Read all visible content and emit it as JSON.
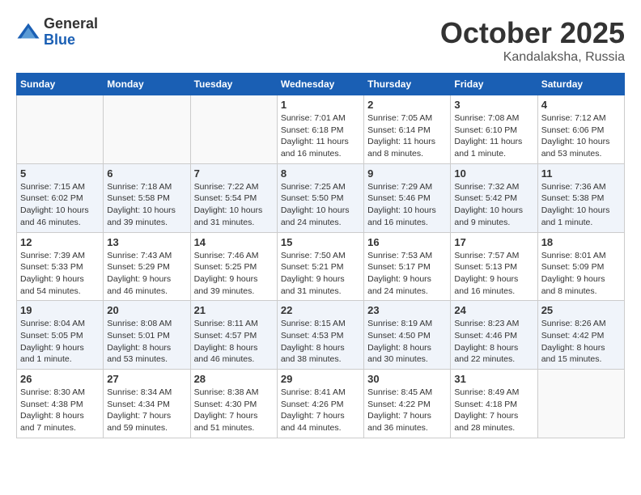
{
  "header": {
    "logo_general": "General",
    "logo_blue": "Blue",
    "month": "October 2025",
    "location": "Kandalaksha, Russia"
  },
  "weekdays": [
    "Sunday",
    "Monday",
    "Tuesday",
    "Wednesday",
    "Thursday",
    "Friday",
    "Saturday"
  ],
  "weeks": [
    [
      {
        "day": "",
        "info": ""
      },
      {
        "day": "",
        "info": ""
      },
      {
        "day": "",
        "info": ""
      },
      {
        "day": "1",
        "info": "Sunrise: 7:01 AM\nSunset: 6:18 PM\nDaylight: 11 hours\nand 16 minutes."
      },
      {
        "day": "2",
        "info": "Sunrise: 7:05 AM\nSunset: 6:14 PM\nDaylight: 11 hours\nand 8 minutes."
      },
      {
        "day": "3",
        "info": "Sunrise: 7:08 AM\nSunset: 6:10 PM\nDaylight: 11 hours\nand 1 minute."
      },
      {
        "day": "4",
        "info": "Sunrise: 7:12 AM\nSunset: 6:06 PM\nDaylight: 10 hours\nand 53 minutes."
      }
    ],
    [
      {
        "day": "5",
        "info": "Sunrise: 7:15 AM\nSunset: 6:02 PM\nDaylight: 10 hours\nand 46 minutes."
      },
      {
        "day": "6",
        "info": "Sunrise: 7:18 AM\nSunset: 5:58 PM\nDaylight: 10 hours\nand 39 minutes."
      },
      {
        "day": "7",
        "info": "Sunrise: 7:22 AM\nSunset: 5:54 PM\nDaylight: 10 hours\nand 31 minutes."
      },
      {
        "day": "8",
        "info": "Sunrise: 7:25 AM\nSunset: 5:50 PM\nDaylight: 10 hours\nand 24 minutes."
      },
      {
        "day": "9",
        "info": "Sunrise: 7:29 AM\nSunset: 5:46 PM\nDaylight: 10 hours\nand 16 minutes."
      },
      {
        "day": "10",
        "info": "Sunrise: 7:32 AM\nSunset: 5:42 PM\nDaylight: 10 hours\nand 9 minutes."
      },
      {
        "day": "11",
        "info": "Sunrise: 7:36 AM\nSunset: 5:38 PM\nDaylight: 10 hours\nand 1 minute."
      }
    ],
    [
      {
        "day": "12",
        "info": "Sunrise: 7:39 AM\nSunset: 5:33 PM\nDaylight: 9 hours\nand 54 minutes."
      },
      {
        "day": "13",
        "info": "Sunrise: 7:43 AM\nSunset: 5:29 PM\nDaylight: 9 hours\nand 46 minutes."
      },
      {
        "day": "14",
        "info": "Sunrise: 7:46 AM\nSunset: 5:25 PM\nDaylight: 9 hours\nand 39 minutes."
      },
      {
        "day": "15",
        "info": "Sunrise: 7:50 AM\nSunset: 5:21 PM\nDaylight: 9 hours\nand 31 minutes."
      },
      {
        "day": "16",
        "info": "Sunrise: 7:53 AM\nSunset: 5:17 PM\nDaylight: 9 hours\nand 24 minutes."
      },
      {
        "day": "17",
        "info": "Sunrise: 7:57 AM\nSunset: 5:13 PM\nDaylight: 9 hours\nand 16 minutes."
      },
      {
        "day": "18",
        "info": "Sunrise: 8:01 AM\nSunset: 5:09 PM\nDaylight: 9 hours\nand 8 minutes."
      }
    ],
    [
      {
        "day": "19",
        "info": "Sunrise: 8:04 AM\nSunset: 5:05 PM\nDaylight: 9 hours\nand 1 minute."
      },
      {
        "day": "20",
        "info": "Sunrise: 8:08 AM\nSunset: 5:01 PM\nDaylight: 8 hours\nand 53 minutes."
      },
      {
        "day": "21",
        "info": "Sunrise: 8:11 AM\nSunset: 4:57 PM\nDaylight: 8 hours\nand 46 minutes."
      },
      {
        "day": "22",
        "info": "Sunrise: 8:15 AM\nSunset: 4:53 PM\nDaylight: 8 hours\nand 38 minutes."
      },
      {
        "day": "23",
        "info": "Sunrise: 8:19 AM\nSunset: 4:50 PM\nDaylight: 8 hours\nand 30 minutes."
      },
      {
        "day": "24",
        "info": "Sunrise: 8:23 AM\nSunset: 4:46 PM\nDaylight: 8 hours\nand 22 minutes."
      },
      {
        "day": "25",
        "info": "Sunrise: 8:26 AM\nSunset: 4:42 PM\nDaylight: 8 hours\nand 15 minutes."
      }
    ],
    [
      {
        "day": "26",
        "info": "Sunrise: 8:30 AM\nSunset: 4:38 PM\nDaylight: 8 hours\nand 7 minutes."
      },
      {
        "day": "27",
        "info": "Sunrise: 8:34 AM\nSunset: 4:34 PM\nDaylight: 7 hours\nand 59 minutes."
      },
      {
        "day": "28",
        "info": "Sunrise: 8:38 AM\nSunset: 4:30 PM\nDaylight: 7 hours\nand 51 minutes."
      },
      {
        "day": "29",
        "info": "Sunrise: 8:41 AM\nSunset: 4:26 PM\nDaylight: 7 hours\nand 44 minutes."
      },
      {
        "day": "30",
        "info": "Sunrise: 8:45 AM\nSunset: 4:22 PM\nDaylight: 7 hours\nand 36 minutes."
      },
      {
        "day": "31",
        "info": "Sunrise: 8:49 AM\nSunset: 4:18 PM\nDaylight: 7 hours\nand 28 minutes."
      },
      {
        "day": "",
        "info": ""
      }
    ]
  ]
}
